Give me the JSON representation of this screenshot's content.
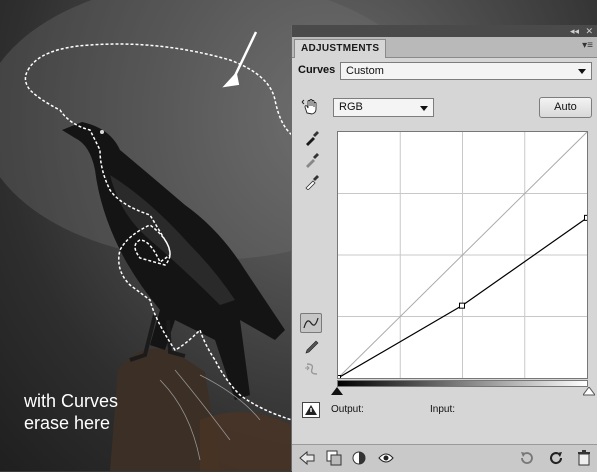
{
  "caption": "with Curves\nerase here",
  "panel": {
    "tab_label": "ADJUSTMENTS",
    "collapse_glyph": "◂◂",
    "close_glyph": "✕",
    "menu_glyph": "▾≡",
    "curves_label": "Curves",
    "preset_value": "Custom",
    "channel_value": "RGB",
    "auto_label": "Auto",
    "output_label": "Output:",
    "input_label": "Input:"
  },
  "curve_points": [
    {
      "input": 0,
      "output": 0
    },
    {
      "input": 127,
      "output": 75
    },
    {
      "input": 255,
      "output": 166
    }
  ],
  "icons": {
    "hand": "on-image-adjust-icon",
    "eyedroppers": [
      "black-point-eyedropper-icon",
      "gray-point-eyedropper-icon",
      "white-point-eyedropper-icon"
    ],
    "curve_tools": [
      "curve-points-tool-icon",
      "pencil-draw-icon",
      "smooth-curve-icon"
    ],
    "bottom": [
      "back-arrow-icon",
      "clip-to-layer-icon",
      "view-previous-state-icon",
      "visibility-eye-icon",
      "reset-icon",
      "refresh-icon",
      "trash-icon"
    ]
  }
}
